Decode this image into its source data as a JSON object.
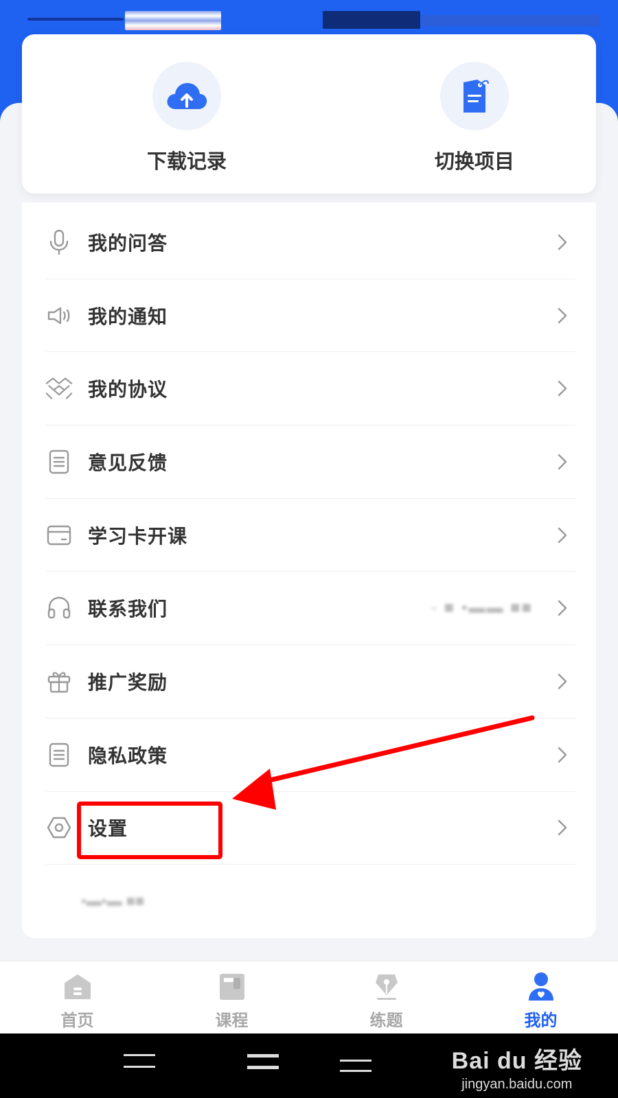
{
  "theme": {
    "accent": "#1f61f0",
    "highlight": "#ff0000"
  },
  "quick_actions": [
    {
      "label": "下载记录",
      "icon": "cloud-upload-icon"
    },
    {
      "label": "切换项目",
      "icon": "tag-document-icon"
    }
  ],
  "menu": {
    "items": [
      {
        "label": "我的问答",
        "icon": "microphone-icon"
      },
      {
        "label": "我的通知",
        "icon": "speaker-icon"
      },
      {
        "label": "我的协议",
        "icon": "handshake-icon"
      },
      {
        "label": "意见反馈",
        "icon": "document-icon"
      },
      {
        "label": "学习卡开课",
        "icon": "card-icon"
      },
      {
        "label": "联系我们",
        "icon": "headset-icon",
        "value": "- ■ ▪▬▬ ■■"
      },
      {
        "label": "推广奖励",
        "icon": "gift-icon"
      },
      {
        "label": "隐私政策",
        "icon": "document-icon"
      },
      {
        "label": "设置",
        "icon": "hexagon-settings-icon"
      }
    ],
    "footer_text": "▪▬▪▬ ■■"
  },
  "tabs": [
    {
      "label": "首页",
      "icon": "home-icon",
      "active": false
    },
    {
      "label": "课程",
      "icon": "course-book-icon",
      "active": false
    },
    {
      "label": "练题",
      "icon": "pen-nib-icon",
      "active": false
    },
    {
      "label": "我的",
      "icon": "user-icon",
      "active": true
    }
  ],
  "watermark": {
    "main": "Bai du 经验",
    "sub": "jingyan.baidu.com"
  }
}
